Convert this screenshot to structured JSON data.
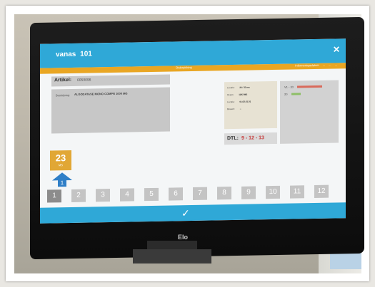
{
  "header": {
    "title_name": "vanas",
    "title_number": "101"
  },
  "orange_bar": {
    "center_text": "Orderpicking",
    "right_text": [
      "Informeringsdatum",
      "...",
      "...",
      "..."
    ]
  },
  "article": {
    "label": "Artikel:",
    "value": "0059096"
  },
  "description": {
    "label": "Beskrijving",
    "value": "ALGODATASE MONO COMPR 1000 MG"
  },
  "details": {
    "rows": [
      {
        "label": "Locatie:",
        "value": "23 / 33 ms"
      },
      {
        "label": "Reeks:",
        "value": "1252 MS"
      },
      {
        "label": "Locatie:",
        "value": "01.02.01.01"
      },
      {
        "label": "Bewerk:",
        "value": "--"
      }
    ]
  },
  "dtl": {
    "label": "DTL:",
    "value": "9 - 12 - 13"
  },
  "right_panel": {
    "rows": [
      {
        "label": "V1 - 20",
        "progress": 0.72,
        "color": "#d96a5b"
      },
      {
        "label": "20",
        "progress": 0.28,
        "color": "#8ebf67"
      }
    ]
  },
  "count_tile": {
    "value": "23",
    "unit": "MS"
  },
  "step_selector": {
    "active_step": 1,
    "arrow_label": "1"
  },
  "steps": [
    "1",
    "2",
    "3",
    "4",
    "5",
    "6",
    "7",
    "8",
    "9",
    "10",
    "11",
    "12"
  ],
  "bottom": {
    "confirm_symbol": "✓"
  },
  "monitor": {
    "brand": "Elo"
  }
}
